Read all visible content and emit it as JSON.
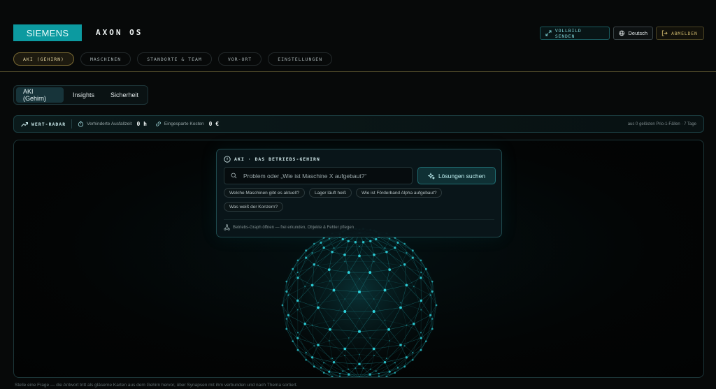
{
  "header": {
    "logo": "SIEMENS",
    "app_title": "AXON OS",
    "fullscreen_label": "VOLLBILD SENDEN",
    "language_label": "Deutsch",
    "logout_label": "ABMELDEN"
  },
  "nav": {
    "items": [
      {
        "label": "AKI (GEHIRN)",
        "active": true
      },
      {
        "label": "MASCHINEN",
        "active": false
      },
      {
        "label": "STANDORTE & TEAM",
        "active": false
      },
      {
        "label": "VOR-ORT",
        "active": false
      },
      {
        "label": "EINSTELLUNGEN",
        "active": false
      }
    ]
  },
  "subtabs": {
    "items": [
      {
        "label": "AKI (Gehirn)",
        "active": true
      },
      {
        "label": "Insights",
        "active": false
      },
      {
        "label": "Sicherheit",
        "active": false
      }
    ]
  },
  "radar": {
    "title": "WERT-RADAR",
    "downtime_label": "Verhinderte Ausfallzeit",
    "downtime_value": "0 h",
    "savings_label": "Eingesparte Kosten",
    "savings_value": "0 €",
    "note": "aus 0 gelösten Prio-1-Fällen · 7 Tage"
  },
  "panel": {
    "title": "AKI · DAS BETRIEBS-GEHIRN",
    "search_placeholder": "Problem oder „Wie ist Maschine X aufgebaut?“",
    "search_button": "Lösungen suchen",
    "chips": [
      "Welche Maschinen gibt es aktuell?",
      "Lager läuft heiß",
      "Wie ist Förderband Alpha aufgebaut?",
      "Was weiß der Konzern?"
    ],
    "footer_link": "Betriebs-Graph öffnen — frei erkunden, Objekte & Fehler pflegen"
  },
  "footer": {
    "hint": "Stelle eine Frage — die Antwort tritt als gläserne Karten aus dem Gehirn hervor, über Synapsen mit ihm verbunden und nach Thema sortiert."
  },
  "colors": {
    "accent_teal": "#0c9aa0",
    "gold": "#c8b36a",
    "node": "#2fd6e0",
    "background": "#070909"
  }
}
